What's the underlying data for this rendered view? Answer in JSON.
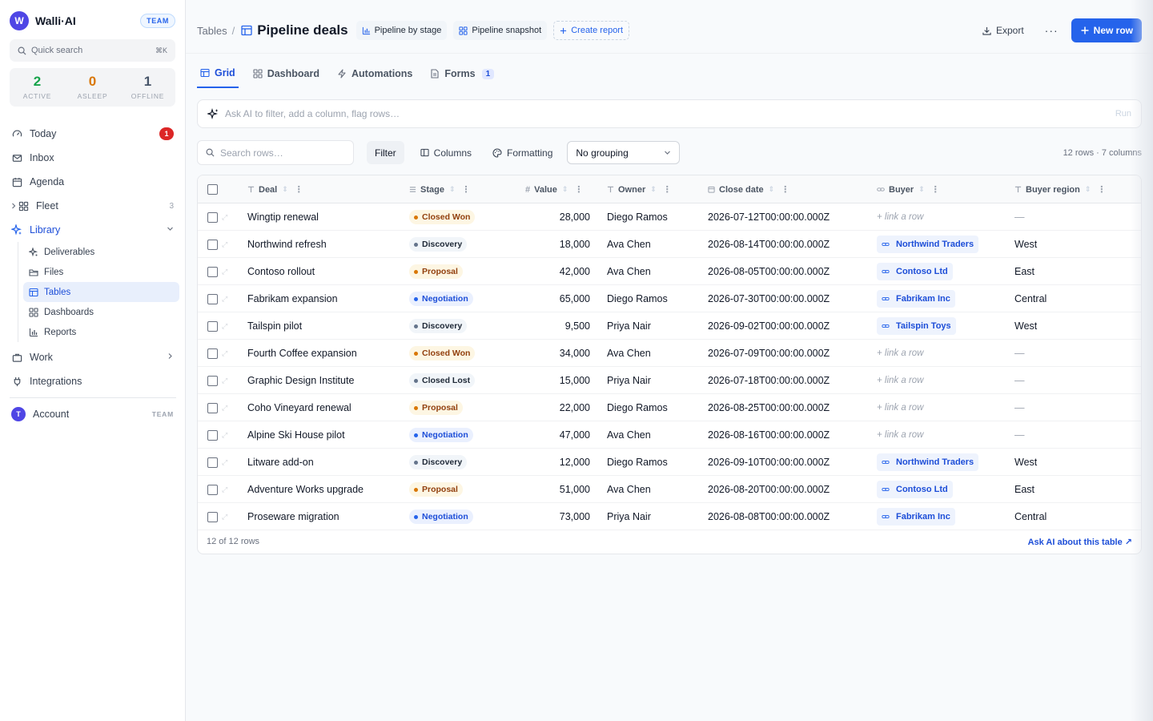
{
  "brand": {
    "logo_letter": "W",
    "name": "Walli·AI",
    "badge": "TEAM"
  },
  "quick_search": {
    "placeholder": "Quick search",
    "shortcut": "⌘K"
  },
  "stats": [
    {
      "value": "2",
      "label": "ACTIVE",
      "color": "#16a34a"
    },
    {
      "value": "0",
      "label": "ASLEEP",
      "color": "#d97706"
    },
    {
      "value": "1",
      "label": "OFFLINE",
      "color": "#475569"
    }
  ],
  "nav": {
    "today": {
      "label": "Today",
      "badge": "1"
    },
    "inbox": {
      "label": "Inbox"
    },
    "agenda": {
      "label": "Agenda"
    },
    "fleet": {
      "label": "Fleet",
      "count": "3"
    },
    "library": {
      "label": "Library"
    },
    "library_items": [
      {
        "label": "Deliverables",
        "icon": "sparkle-icon"
      },
      {
        "label": "Files",
        "icon": "folder-icon"
      },
      {
        "label": "Tables",
        "icon": "table-icon"
      },
      {
        "label": "Dashboards",
        "icon": "dashboard-icon"
      },
      {
        "label": "Reports",
        "icon": "bar-chart-icon"
      }
    ],
    "work": {
      "label": "Work"
    },
    "integrations": {
      "label": "Integrations"
    },
    "account": {
      "label": "Account",
      "initial": "T",
      "tag": "TEAM"
    }
  },
  "header": {
    "breadcrumb": "Tables",
    "separator": "/",
    "title": "Pipeline deals",
    "chips": [
      "Pipeline by stage",
      "Pipeline snapshot"
    ],
    "create_report": "Create report",
    "export": "Export",
    "more": "···",
    "new_row": "New row"
  },
  "tabs": [
    {
      "label": "Grid",
      "active": true
    },
    {
      "label": "Dashboard"
    },
    {
      "label": "Automations"
    },
    {
      "label": "Forms",
      "count": "1"
    }
  ],
  "ai_bar": {
    "placeholder": "Ask AI to filter, add a column, flag rows…",
    "run": "Run"
  },
  "toolbar": {
    "search_placeholder": "Search rows…",
    "filter": "Filter",
    "columns": "Columns",
    "formatting": "Formatting",
    "grouping": "No grouping",
    "row_count": "12 rows · 7 columns"
  },
  "table": {
    "columns": [
      "Deal",
      "Stage",
      "Value",
      "Owner",
      "Close date",
      "Buyer",
      "Buyer region"
    ],
    "link_placeholder": "+ link a row",
    "empty": "—",
    "rows": [
      {
        "deal": "Wingtip renewal",
        "stage": "Closed Won",
        "stage_kind": "won",
        "value": "28,000",
        "owner": "Diego Ramos",
        "close": "2026-07-12T00:00:00.000Z",
        "buyer": "",
        "region": ""
      },
      {
        "deal": "Northwind refresh",
        "stage": "Discovery",
        "stage_kind": "discovery",
        "value": "18,000",
        "owner": "Ava Chen",
        "close": "2026-08-14T00:00:00.000Z",
        "buyer": "Northwind Traders",
        "region": "West"
      },
      {
        "deal": "Contoso rollout",
        "stage": "Proposal",
        "stage_kind": "proposal",
        "value": "42,000",
        "owner": "Ava Chen",
        "close": "2026-08-05T00:00:00.000Z",
        "buyer": "Contoso Ltd",
        "region": "East"
      },
      {
        "deal": "Fabrikam expansion",
        "stage": "Negotiation",
        "stage_kind": "negotiation",
        "value": "65,000",
        "owner": "Diego Ramos",
        "close": "2026-07-30T00:00:00.000Z",
        "buyer": "Fabrikam Inc",
        "region": "Central"
      },
      {
        "deal": "Tailspin pilot",
        "stage": "Discovery",
        "stage_kind": "discovery",
        "value": "9,500",
        "owner": "Priya Nair",
        "close": "2026-09-02T00:00:00.000Z",
        "buyer": "Tailspin Toys",
        "region": "West"
      },
      {
        "deal": "Fourth Coffee expansion",
        "stage": "Closed Won",
        "stage_kind": "won",
        "value": "34,000",
        "owner": "Ava Chen",
        "close": "2026-07-09T00:00:00.000Z",
        "buyer": "",
        "region": ""
      },
      {
        "deal": "Graphic Design Institute",
        "stage": "Closed Lost",
        "stage_kind": "lost",
        "value": "15,000",
        "owner": "Priya Nair",
        "close": "2026-07-18T00:00:00.000Z",
        "buyer": "",
        "region": ""
      },
      {
        "deal": "Coho Vineyard renewal",
        "stage": "Proposal",
        "stage_kind": "proposal",
        "value": "22,000",
        "owner": "Diego Ramos",
        "close": "2026-08-25T00:00:00.000Z",
        "buyer": "",
        "region": ""
      },
      {
        "deal": "Alpine Ski House pilot",
        "stage": "Negotiation",
        "stage_kind": "negotiation",
        "value": "47,000",
        "owner": "Ava Chen",
        "close": "2026-08-16T00:00:00.000Z",
        "buyer": "",
        "region": ""
      },
      {
        "deal": "Litware add-on",
        "stage": "Discovery",
        "stage_kind": "discovery",
        "value": "12,000",
        "owner": "Diego Ramos",
        "close": "2026-09-10T00:00:00.000Z",
        "buyer": "Northwind Traders",
        "region": "West"
      },
      {
        "deal": "Adventure Works upgrade",
        "stage": "Proposal",
        "stage_kind": "proposal",
        "value": "51,000",
        "owner": "Ava Chen",
        "close": "2026-08-20T00:00:00.000Z",
        "buyer": "Contoso Ltd",
        "region": "East"
      },
      {
        "deal": "Proseware migration",
        "stage": "Negotiation",
        "stage_kind": "negotiation",
        "value": "73,000",
        "owner": "Priya Nair",
        "close": "2026-08-08T00:00:00.000Z",
        "buyer": "Fabrikam Inc",
        "region": "Central"
      }
    ],
    "footer_count": "12 of 12 rows",
    "ask_ai": "Ask AI about this table ↗"
  }
}
